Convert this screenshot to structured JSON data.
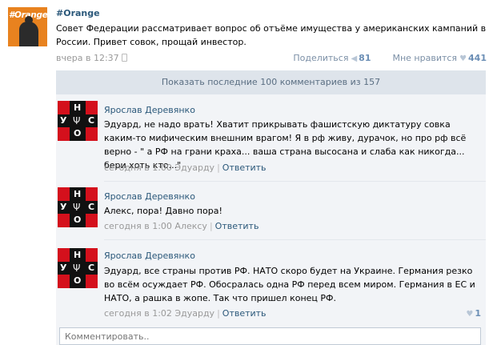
{
  "post": {
    "avatar_tag": "#Orange",
    "author": "#Orange",
    "text": "Совет Федерации рассматривает вопрос об отъёме имущества у американских кампаний в России. Привет совок, прощай инвестор.",
    "time": "вчера в 12:37",
    "share_label": "Поделиться",
    "share_count": "81",
    "like_label": "Мне нравится",
    "like_count": "441"
  },
  "comments_header": "Показать последние 100 комментариев из 157",
  "avatar_letters": {
    "top": "Н",
    "left": "У",
    "right": "С",
    "bottom": "О"
  },
  "comments": [
    {
      "author": "Ярослав Деревянко",
      "text": "Эдуард, не надо врать! Хватит прикрывать фашистскую диктатуру совка каким-то мифическим внешним врагом! Я в рф живу, дурачок, но про рф всё верно - \" а РФ на грани краха... ваша страна высосана и слаба как никогда... бери хоть кто...\"",
      "time": "сегодня в 1:00",
      "reply_to": "Эдуарду",
      "reply_label": "Ответить"
    },
    {
      "author": "Ярослав Деревянко",
      "text": "Алекс, пора! Давно пора!",
      "time": "сегодня в 1:00",
      "reply_to": "Алексу",
      "reply_label": "Ответить"
    },
    {
      "author": "Ярослав Деревянко",
      "text": "Эдуард, все страны против РФ. НАТО скоро будет на Украине. Германия резко во всём осуждает РФ. Обосралась одна РФ перед всем миром. Германия в ЕС и НАТО, а рашка в жопе. Так что пришел конец РФ.",
      "time": "сегодня в 1:02",
      "reply_to": "Эдуарду",
      "reply_label": "Ответить",
      "likes": "1"
    }
  ],
  "reply_placeholder": "Комментировать.."
}
